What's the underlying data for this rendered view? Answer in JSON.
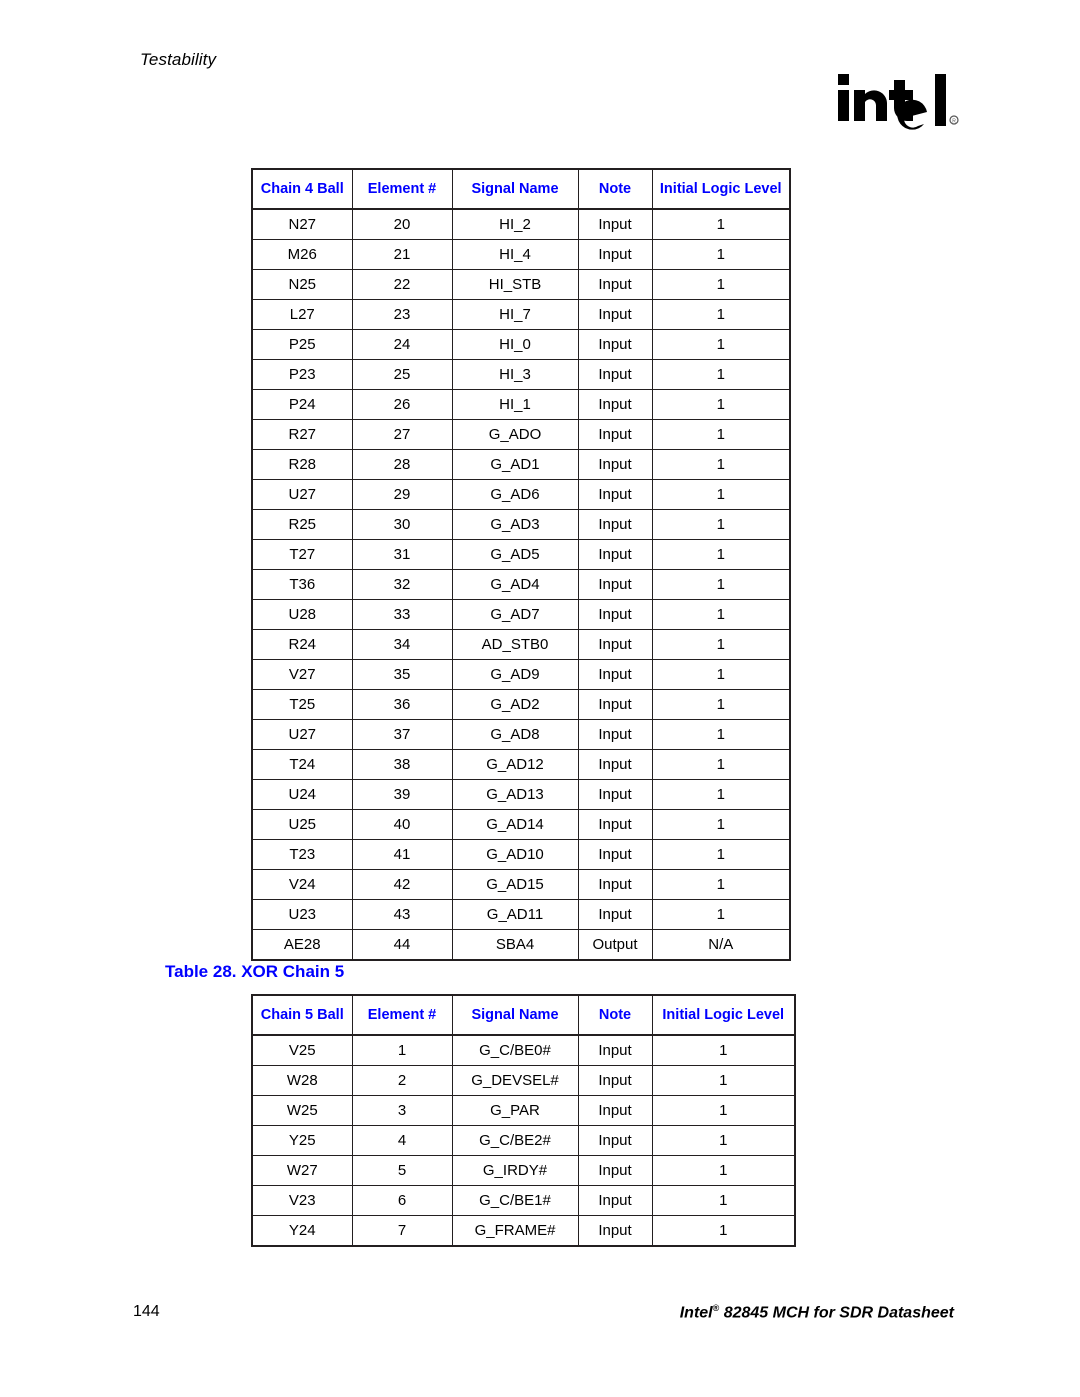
{
  "page": {
    "running_head": "Testability",
    "logo_alt": "intel",
    "footer_page_number": "144",
    "footer_title_prefix": "Intel",
    "footer_title_registered": "®",
    "footer_title_suffix": " 82845 MCH for SDR Datasheet",
    "accent_blue": "#0000FF",
    "rule_color": "#231F20"
  },
  "table4": {
    "columns": [
      "Chain 4 Ball",
      "Element #",
      "Signal Name",
      "Note",
      "Initial Logic Level"
    ],
    "rows": [
      [
        "N27",
        "20",
        "HI_2",
        "Input",
        "1"
      ],
      [
        "M26",
        "21",
        "HI_4",
        "Input",
        "1"
      ],
      [
        "N25",
        "22",
        "HI_STB",
        "Input",
        "1"
      ],
      [
        "L27",
        "23",
        "HI_7",
        "Input",
        "1"
      ],
      [
        "P25",
        "24",
        "HI_0",
        "Input",
        "1"
      ],
      [
        "P23",
        "25",
        "HI_3",
        "Input",
        "1"
      ],
      [
        "P24",
        "26",
        "HI_1",
        "Input",
        "1"
      ],
      [
        "R27",
        "27",
        "G_ADO",
        "Input",
        "1"
      ],
      [
        "R28",
        "28",
        "G_AD1",
        "Input",
        "1"
      ],
      [
        "U27",
        "29",
        "G_AD6",
        "Input",
        "1"
      ],
      [
        "R25",
        "30",
        "G_AD3",
        "Input",
        "1"
      ],
      [
        "T27",
        "31",
        "G_AD5",
        "Input",
        "1"
      ],
      [
        "T36",
        "32",
        "G_AD4",
        "Input",
        "1"
      ],
      [
        "U28",
        "33",
        "G_AD7",
        "Input",
        "1"
      ],
      [
        "R24",
        "34",
        "AD_STB0",
        "Input",
        "1"
      ],
      [
        "V27",
        "35",
        "G_AD9",
        "Input",
        "1"
      ],
      [
        "T25",
        "36",
        "G_AD2",
        "Input",
        "1"
      ],
      [
        "U27",
        "37",
        "G_AD8",
        "Input",
        "1"
      ],
      [
        "T24",
        "38",
        "G_AD12",
        "Input",
        "1"
      ],
      [
        "U24",
        "39",
        "G_AD13",
        "Input",
        "1"
      ],
      [
        "U25",
        "40",
        "G_AD14",
        "Input",
        "1"
      ],
      [
        "T23",
        "41",
        "G_AD10",
        "Input",
        "1"
      ],
      [
        "V24",
        "42",
        "G_AD15",
        "Input",
        "1"
      ],
      [
        "U23",
        "43",
        "G_AD11",
        "Input",
        "1"
      ],
      [
        "AE28",
        "44",
        "SBA4",
        "Output",
        "N/A"
      ]
    ]
  },
  "caption28": "Table 28. XOR Chain 5",
  "table5": {
    "columns": [
      "Chain 5 Ball",
      "Element #",
      "Signal Name",
      "Note",
      "Initial Logic Level"
    ],
    "rows": [
      [
        "V25",
        "1",
        "G_C/BE0#",
        "Input",
        "1"
      ],
      [
        "W28",
        "2",
        "G_DEVSEL#",
        "Input",
        "1"
      ],
      [
        "W25",
        "3",
        "G_PAR",
        "Input",
        "1"
      ],
      [
        "Y25",
        "4",
        "G_C/BE2#",
        "Input",
        "1"
      ],
      [
        "W27",
        "5",
        "G_IRDY#",
        "Input",
        "1"
      ],
      [
        "V23",
        "6",
        "G_C/BE1#",
        "Input",
        "1"
      ],
      [
        "Y24",
        "7",
        "G_FRAME#",
        "Input",
        "1"
      ]
    ]
  }
}
